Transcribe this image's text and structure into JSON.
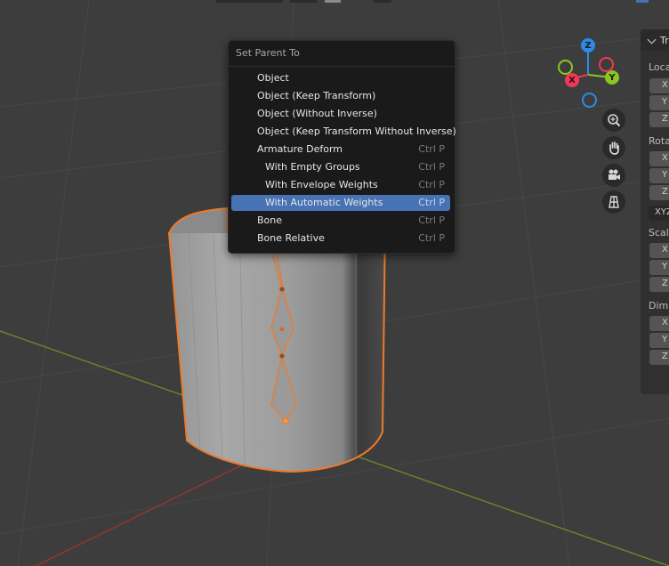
{
  "menu": {
    "title": "Set Parent To",
    "items": [
      {
        "label": "Object",
        "shortcut": ""
      },
      {
        "label": "Object (Keep Transform)",
        "shortcut": ""
      },
      {
        "label": "Object (Without Inverse)",
        "shortcut": ""
      },
      {
        "label": "Object (Keep Transform Without Inverse)",
        "shortcut": ""
      },
      {
        "label": "Armature Deform",
        "shortcut": "Ctrl P"
      },
      {
        "label": "With Empty Groups",
        "shortcut": "Ctrl P"
      },
      {
        "label": "With Envelope Weights",
        "shortcut": "Ctrl P"
      },
      {
        "label": "With Automatic Weights",
        "shortcut": "Ctrl P"
      },
      {
        "label": "Bone",
        "shortcut": "Ctrl P"
      },
      {
        "label": "Bone Relative",
        "shortcut": "Ctrl P"
      }
    ],
    "active_item": "With Automatic Weights"
  },
  "gizmo": {
    "z_label": "Z",
    "y_label": "Y",
    "x_label": "X",
    "colors": {
      "x": "#f53756",
      "y": "#8bc721",
      "z": "#2e8ae6"
    }
  },
  "nav_buttons": [
    "zoom-icon",
    "hand-icon",
    "camera-icon",
    "grid-icon"
  ],
  "panel": {
    "title": "Tr",
    "location_label": "Loca",
    "rotation_label": "Rota",
    "rotation_mode": "XYZ",
    "scale_label": "Scal",
    "dimensions_label": "Dim",
    "axis_labels": [
      "X",
      "Y",
      "Z"
    ]
  }
}
